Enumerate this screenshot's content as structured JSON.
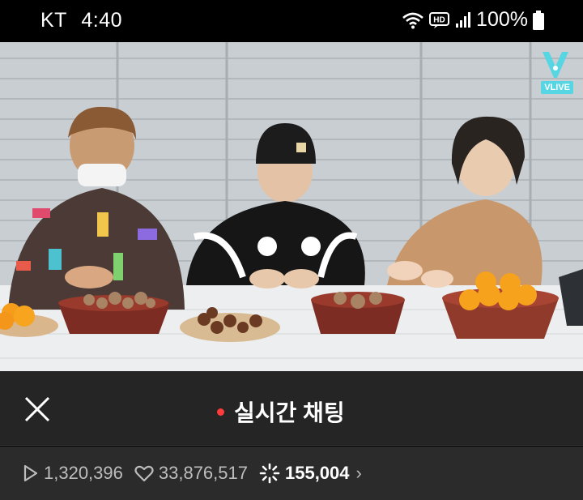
{
  "status_bar": {
    "carrier": "KT",
    "time": "4:40",
    "hd_label": "HD",
    "battery": "100%"
  },
  "video": {
    "logo_text": "VLIVE"
  },
  "chat": {
    "title": "실시간 채팅",
    "live_color": "#ff3b3b"
  },
  "stats": {
    "plays": "1,320,396",
    "likes": "33,876,517",
    "viewers": "155,004"
  },
  "colors": {
    "brand": "#56d6e3",
    "header_bg": "#252525",
    "stats_bg": "#2b2b2b"
  }
}
